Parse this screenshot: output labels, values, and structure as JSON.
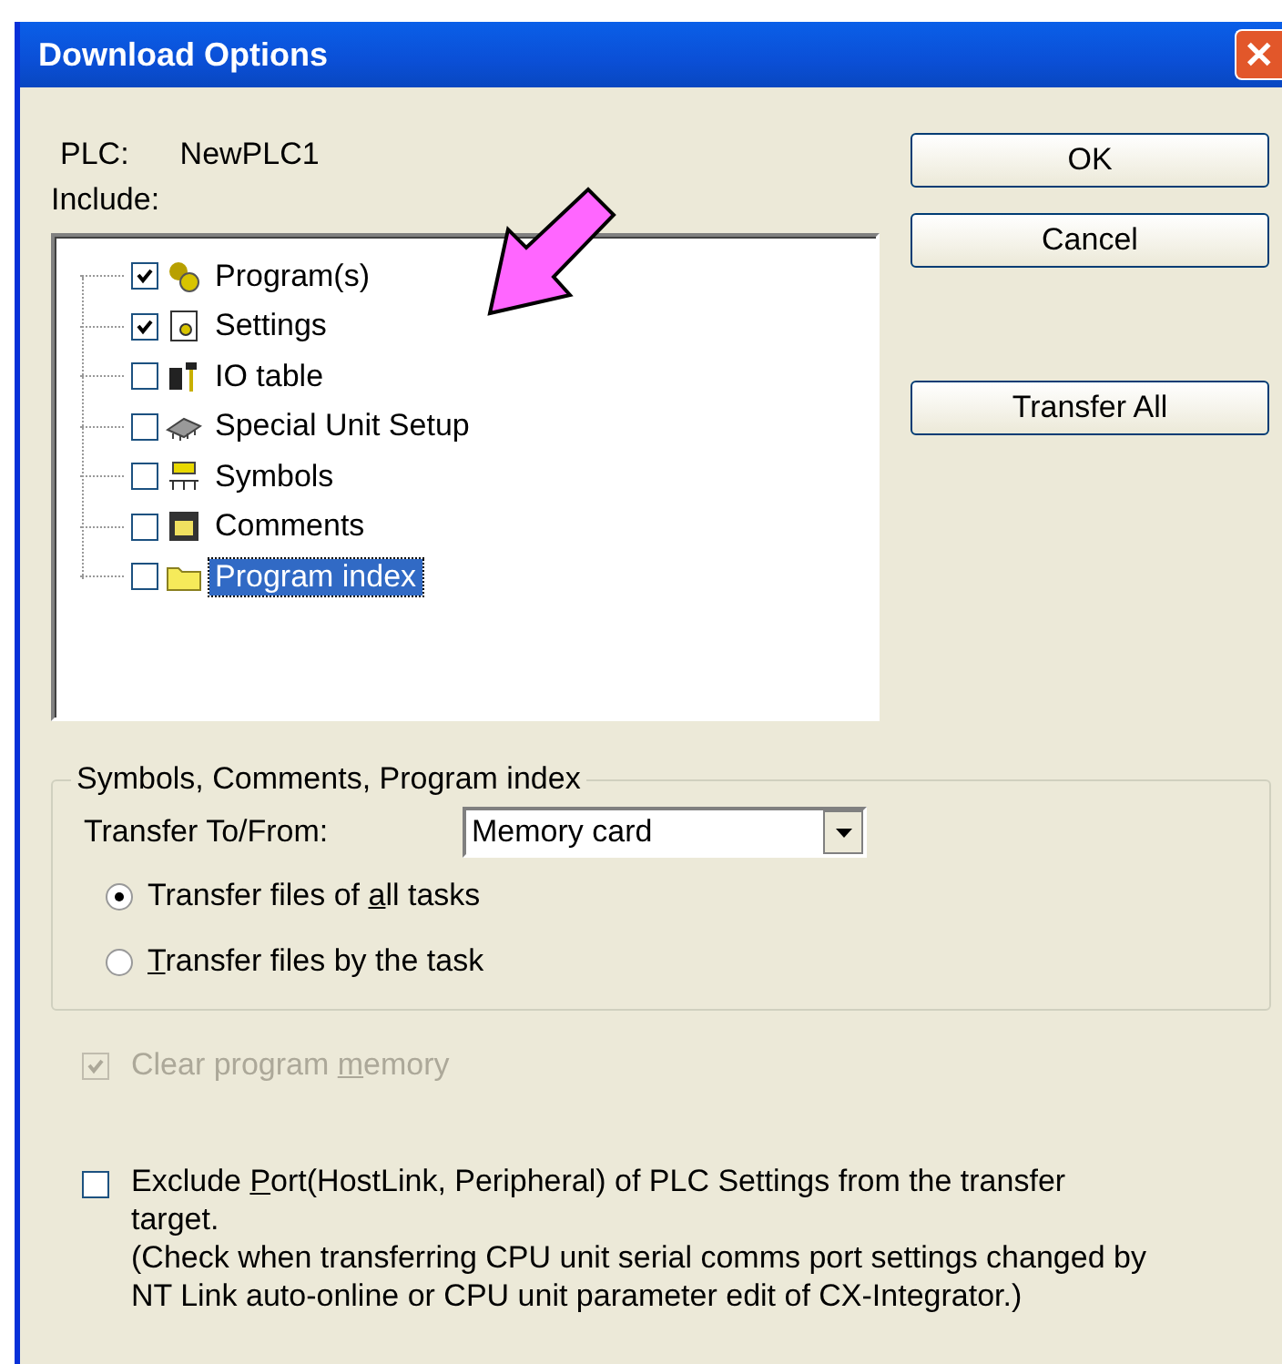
{
  "window": {
    "title": "Download Options",
    "close": "✕"
  },
  "plc": {
    "label": "PLC:",
    "value": "NewPLC1"
  },
  "include": {
    "label": "Include:",
    "items": [
      {
        "kind": "program",
        "label": "Program(s)",
        "checked": true,
        "selected": false
      },
      {
        "kind": "settings",
        "label": "Settings",
        "checked": true,
        "selected": false
      },
      {
        "kind": "io",
        "label": "IO table",
        "checked": false,
        "selected": false
      },
      {
        "kind": "unit",
        "label": "Special Unit Setup",
        "checked": false,
        "selected": false
      },
      {
        "kind": "symbols",
        "label": "Symbols",
        "checked": false,
        "selected": false
      },
      {
        "kind": "comments",
        "label": "Comments",
        "checked": false,
        "selected": false
      },
      {
        "kind": "folder",
        "label": "Program index",
        "checked": false,
        "selected": true
      }
    ]
  },
  "buttons": [
    {
      "label": "OK"
    },
    {
      "label": "Cancel"
    },
    {
      "label": "Transfer All"
    }
  ],
  "group": {
    "title": "Symbols, Comments, Program index",
    "transfer_label": "Transfer To/From:",
    "transfer_value": "Memory card",
    "radios": [
      {
        "before": "Transfer files of ",
        "key": "a",
        "after": "ll tasks",
        "selected": true
      },
      {
        "key": "T",
        "after": "ransfer files by the task",
        "selected": false
      }
    ]
  },
  "clear": {
    "before": "Clear program ",
    "key": "m",
    "after": "emory",
    "checked": true,
    "disabled": true
  },
  "exclude": {
    "before": "Exclude ",
    "key": "P",
    "after": "ort(HostLink, Peripheral) of PLC Settings from the transfer target.",
    "note": "(Check when transferring CPU unit serial comms port settings changed by NT Link auto-online or CPU unit parameter edit of CX-Integrator.)",
    "checked": false,
    "disabled": false
  }
}
